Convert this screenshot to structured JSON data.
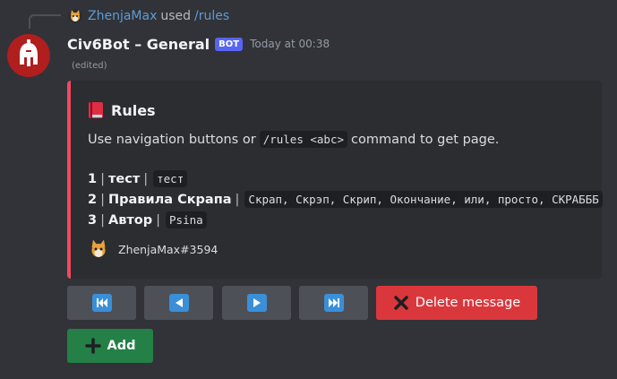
{
  "reply": {
    "username": "ZhenjaMax",
    "used": "used",
    "command": "/rules"
  },
  "message": {
    "author": "Civ6Bot – General",
    "bot_tag": "BOT",
    "timestamp": "Today at 00:38",
    "edited": "(edited)"
  },
  "embed": {
    "accent_color": "#f1495e",
    "title": "Rules",
    "title_icon": "red-book-icon",
    "description": {
      "before": "Use navigation buttons or",
      "code": "/rules <abc>",
      "after": "command to get page."
    },
    "rules": [
      {
        "num": "1",
        "name": "тест",
        "value": "тест"
      },
      {
        "num": "2",
        "name": "Правила Скрапа",
        "value": "Скрап, Скрэп, Скрип, Окончание, или, просто, СКРАБББ"
      },
      {
        "num": "3",
        "name": "Автор",
        "value": "Psina"
      }
    ],
    "separator": "|",
    "footer": "ZhenjaMax#3594"
  },
  "buttons": {
    "first": "first-page-icon",
    "prev": "previous-page-icon",
    "next": "next-page-icon",
    "last": "last-page-icon",
    "delete_label": "Delete message",
    "add_label": "Add"
  },
  "colors": {
    "background": "#313338",
    "embed_bg": "#2b2d31",
    "blurple": "#5865f2",
    "danger": "#da373c",
    "success": "#248046",
    "nav_button": "#4e5058",
    "link": "#5e9bd6"
  }
}
